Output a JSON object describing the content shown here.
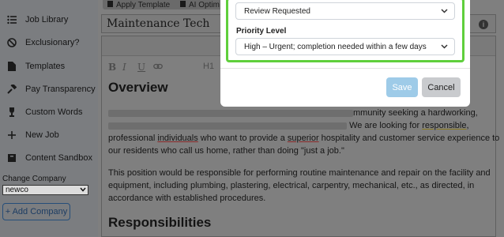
{
  "sidebar": {
    "items": [
      {
        "label": "Job Library",
        "icon": "list-icon"
      },
      {
        "label": "Exclusionary?",
        "icon": "ban-icon"
      },
      {
        "label": "Templates",
        "icon": "file-icon"
      },
      {
        "label": "Pay Transparency",
        "icon": "hammer-icon"
      },
      {
        "label": "Custom Words",
        "icon": "trophy-icon"
      },
      {
        "label": "New Job",
        "icon": "plus-icon"
      },
      {
        "label": "Content Sandbox",
        "icon": "box-icon"
      }
    ],
    "change_company_label": "Change Company",
    "company_value": "newco",
    "add_company_label": "+ Add Company"
  },
  "toolbar": {
    "apply_template": "Apply Template",
    "ai_optimize": "AI Optim"
  },
  "editor": {
    "title": "Maintenance Tech",
    "format_buttons": [
      "B",
      "I",
      "U",
      "H1"
    ],
    "heading_overview": "Overview",
    "line1_visible": "mmunity seeking a hardworking,",
    "line2_pre": "We are looking for ",
    "line2_word": "responsible",
    "line2_post": ",",
    "line3_a": "professional ",
    "line3_b": "individuals",
    "line3_c": " who want to provide a ",
    "line3_d": "superior",
    "line3_e": " hospitality and customer service experience to",
    "line4": "our residents who call us home, rather than doing \"just a job.\"",
    "para2_l1": "This position would be responsible for performing routine maintenance and repair on the facility and",
    "para2_l2": "equipment, including plumbing, plastering, electrical, carpentry, mechanical, etc., as directed, in",
    "para2_l3": "accordance with established procedures.",
    "heading_responsibilities": "Responsibilities"
  },
  "modal": {
    "status_value": "Review Requested",
    "priority_label": "Priority Level",
    "priority_value": "High – Urgent; completion needed within a few days",
    "save_label": "Save",
    "cancel_label": "Cancel"
  },
  "colors": {
    "highlight_border": "#5fcf3c",
    "save_button": "#9ecbe8",
    "cancel_button": "#c9cbce"
  }
}
